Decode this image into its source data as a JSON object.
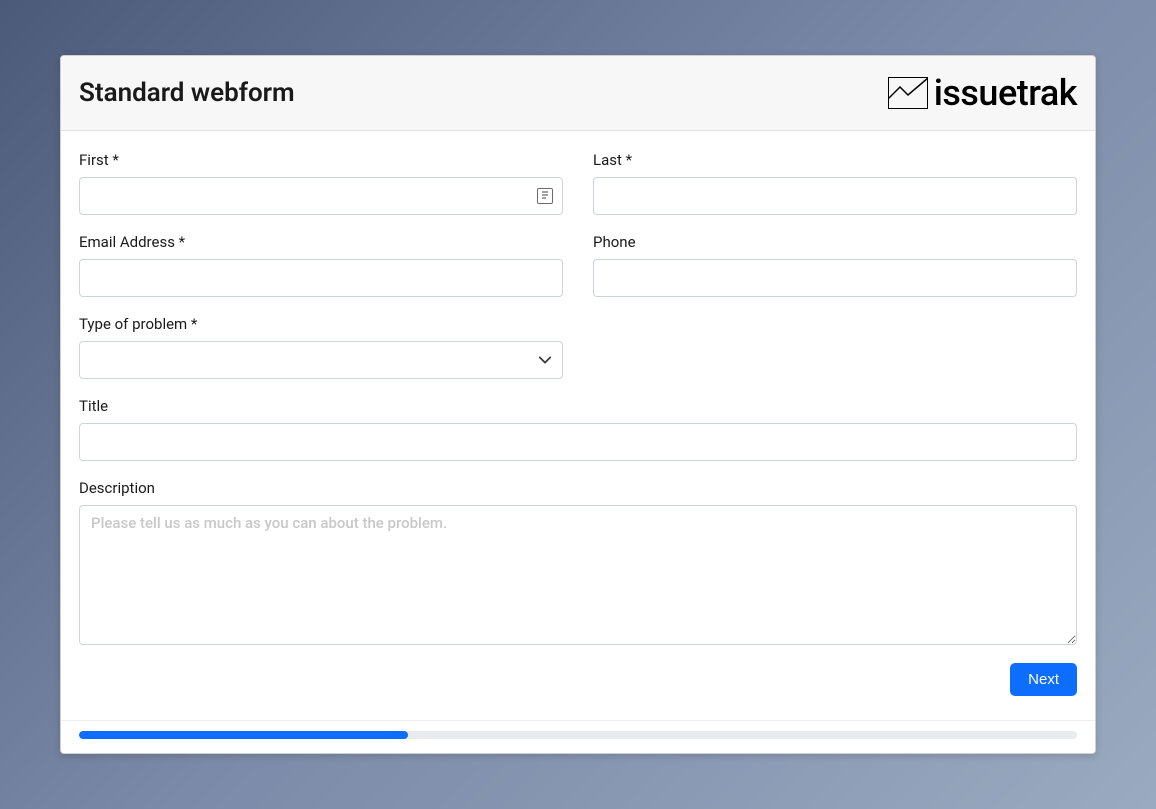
{
  "header": {
    "title": "Standard webform",
    "brand": "issuetrak"
  },
  "fields": {
    "first": {
      "label": "First *",
      "value": ""
    },
    "last": {
      "label": "Last *",
      "value": ""
    },
    "email": {
      "label": "Email Address *",
      "value": ""
    },
    "phone": {
      "label": "Phone",
      "value": ""
    },
    "problem_type": {
      "label": "Type of problem *",
      "value": ""
    },
    "title": {
      "label": "Title",
      "value": ""
    },
    "description": {
      "label": "Description",
      "placeholder": "Please tell us as much as you can about the problem.",
      "value": ""
    }
  },
  "buttons": {
    "next": "Next"
  },
  "progress": {
    "percent": 33
  }
}
